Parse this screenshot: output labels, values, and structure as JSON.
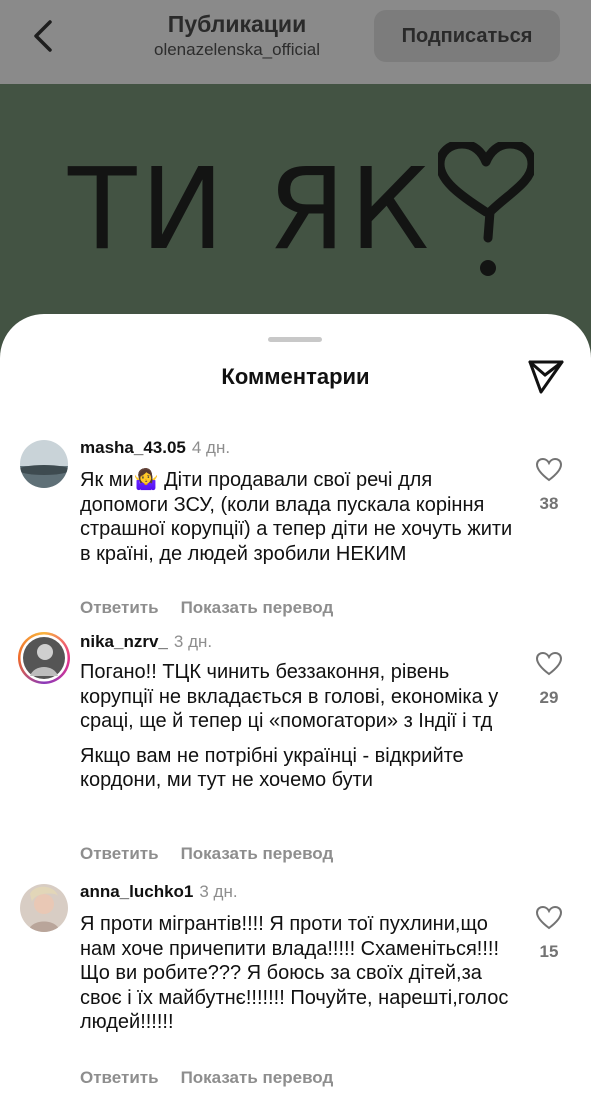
{
  "header": {
    "title": "Публикации",
    "subtitle": "olenazelenska_official",
    "subscribe_label": "Подписаться"
  },
  "post": {
    "image_text": "ТИ ЯК"
  },
  "sheet": {
    "title": "Комментарии"
  },
  "comments": [
    {
      "username": "masha_43.05",
      "age": "4 дн.",
      "text": "Як ми🤷‍♀️ Діти продавали свої речі для допомоги ЗСУ, (коли влада пускала коріння страшної корупції) а тепер діти не хочуть жити в країні, де людей зробили НЕКИМ",
      "reply_label": "Ответить",
      "translate_label": "Показать перевод",
      "likes": "38"
    },
    {
      "username": "nika_nzrv_",
      "age": "3 дн.",
      "text": "Погано!! ТЦК чинить беззаконня, рівень корупції не вкладається в голові, економіка у сраці, ще й тепер ці «помогатори» з Індії і тд",
      "text2": "Якщо вам не потрібні українці - відкрийте кордони, ми тут не хочемо бути",
      "reply_label": "Ответить",
      "translate_label": "Показать перевод",
      "likes": "29"
    },
    {
      "username": "anna_luchko1",
      "age": "3 дн.",
      "text": "Я проти мігрантів!!!! Я проти тої пухлини,що нам хоче причепити влада!!!!! Схаменіться!!!! Що ви робите??? Я боюсь за своїх дітей,за своє і їх майбутнє!!!!!!! Почуйте, нарешті,голос людей!!!!!!",
      "reply_label": "Ответить",
      "translate_label": "Показать перевод",
      "likes": "15"
    }
  ],
  "colors": {
    "header_dim": "#8a8a8a",
    "post_bg": "#435343",
    "secondary_text": "#8e8e8e"
  }
}
